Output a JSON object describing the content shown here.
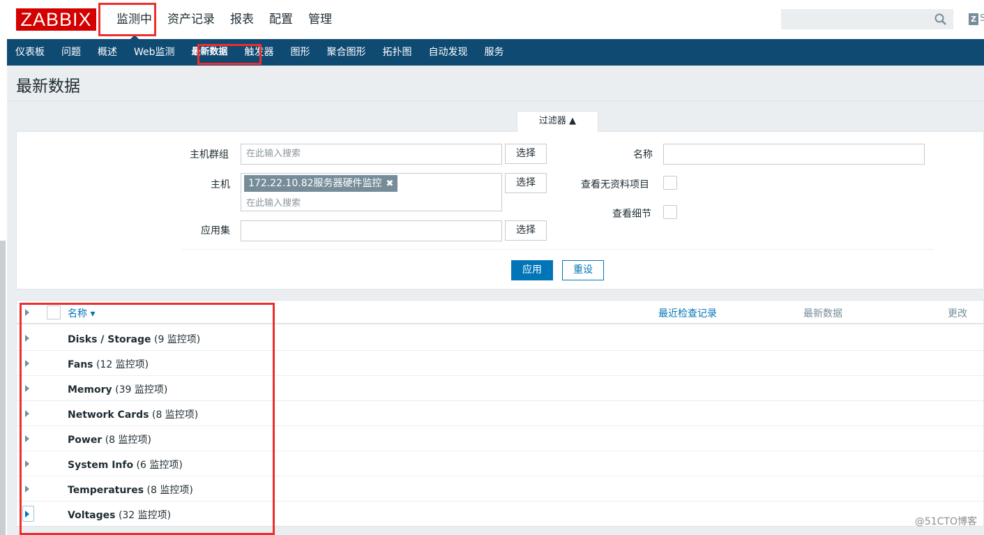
{
  "header": {
    "logo": "ZABBIX",
    "nav": [
      "监测中",
      "资产记录",
      "报表",
      "配置",
      "管理"
    ],
    "active_nav": 0,
    "zlink_letter": "Z",
    "zlink_text": "S"
  },
  "subnav": {
    "items": [
      "仪表板",
      "问题",
      "概述",
      "Web监测",
      "最新数据",
      "触发器",
      "图形",
      "聚合图形",
      "拓扑图",
      "自动发现",
      "服务"
    ],
    "active": 4
  },
  "page_title": "最新数据",
  "filter": {
    "tab_label": "过滤器 ▲",
    "host_group_label": "主机群组",
    "host_group_placeholder": "在此输入搜索",
    "host_label": "主机",
    "host_tag": "172.22.10.82服务器硬件监控",
    "host_tag_remove": "✖",
    "host_placeholder": "在此输入搜索",
    "application_label": "应用集",
    "select_label": "选择",
    "name_label": "名称",
    "show_no_data_label": "查看无资料项目",
    "show_details_label": "查看细节",
    "apply_label": "应用",
    "reset_label": "重设"
  },
  "table": {
    "columns": {
      "name": "名称 ▾",
      "last_check": "最近检查记录",
      "last_value": "最新数据",
      "change": "更改"
    },
    "rows": [
      {
        "name": "Disks / Storage",
        "count": "(9 监控项)"
      },
      {
        "name": "Fans",
        "count": "(12 监控项)"
      },
      {
        "name": "Memory",
        "count": "(39 监控项)"
      },
      {
        "name": "Network Cards",
        "count": "(8 监控项)"
      },
      {
        "name": "Power",
        "count": "(8 监控项)"
      },
      {
        "name": "System Info",
        "count": "(6 监控项)"
      },
      {
        "name": "Temperatures",
        "count": "(8 监控项)"
      },
      {
        "name": "Voltages",
        "count": "(32 监控项)"
      }
    ]
  },
  "watermark": "@51CTO博客",
  "colors": {
    "logo_red": "#d40000",
    "subnav_blue": "#0f4a73",
    "link_blue": "#0275b8",
    "annotation_red": "#ee2d2d"
  }
}
